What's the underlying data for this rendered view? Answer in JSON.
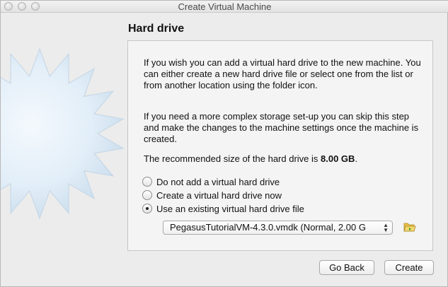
{
  "window": {
    "title": "Create Virtual Machine"
  },
  "page": {
    "title": "Hard drive"
  },
  "panel": {
    "para1": "If you wish you can add a virtual hard drive to the new machine. You can either create a new hard drive file or select one from the list or from another location using the folder icon.",
    "para2": "If you need a more complex storage set-up you can skip this step and make the changes to the machine settings once the machine is created.",
    "recommended_prefix": "The recommended size of the hard drive is ",
    "recommended_size": "8.00 GB",
    "recommended_suffix": "."
  },
  "options": [
    {
      "label": "Do not add a virtual hard drive",
      "checked": false
    },
    {
      "label": "Create a virtual hard drive now",
      "checked": false
    },
    {
      "label": "Use an existing virtual hard drive file",
      "checked": true
    }
  ],
  "disk_select": {
    "value": "PegasusTutorialVM-4.3.0.vmdk (Normal, 2.00 G"
  },
  "buttons": {
    "back": "Go Back",
    "create": "Create"
  },
  "icons": {
    "folder": "folder-open-icon"
  }
}
